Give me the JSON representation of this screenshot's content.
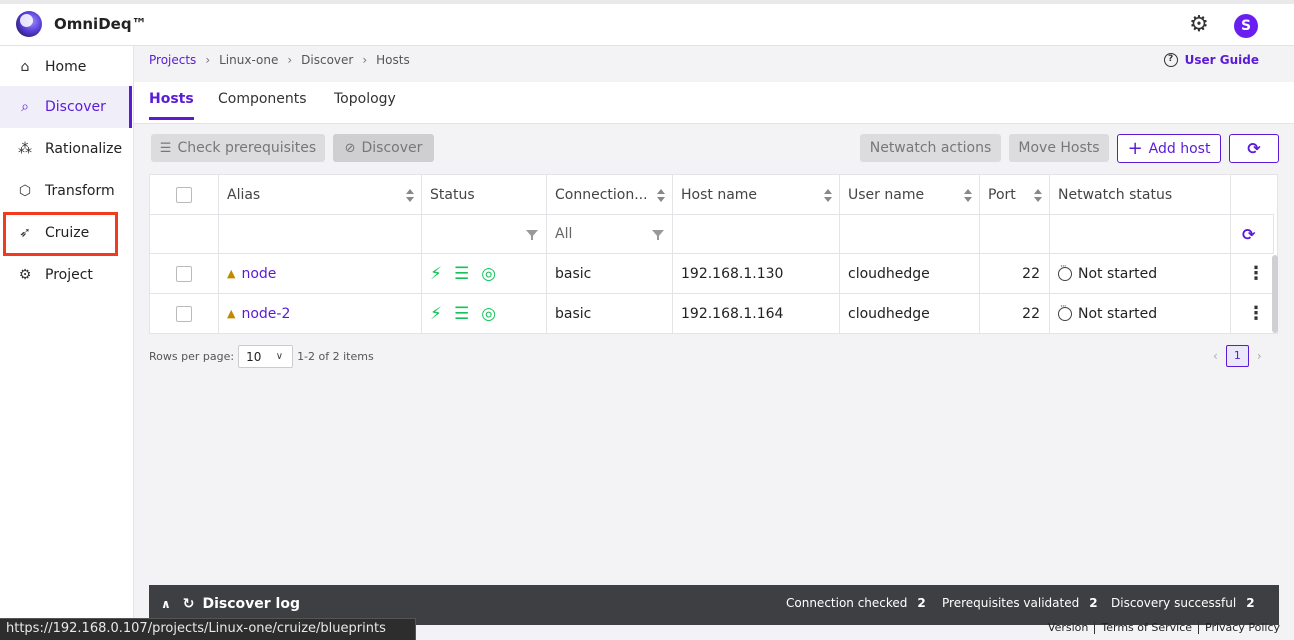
{
  "app": {
    "brand": "OmniDeq™",
    "avatar_letter": "S"
  },
  "sidebar": {
    "items": [
      {
        "label": "Home",
        "icon": "home-icon"
      },
      {
        "label": "Discover",
        "icon": "discover-icon",
        "active": true
      },
      {
        "label": "Rationalize",
        "icon": "rationalize-icon"
      },
      {
        "label": "Transform",
        "icon": "cube-icon"
      },
      {
        "label": "Cruize",
        "icon": "cruize-icon",
        "highlighted": true
      },
      {
        "label": "Project",
        "icon": "gear-icon"
      }
    ]
  },
  "breadcrumb": [
    "Projects",
    "Linux-one",
    "Discover",
    "Hosts"
  ],
  "user_guide": "User Guide",
  "tabs": [
    {
      "label": "Hosts",
      "active": true
    },
    {
      "label": "Components"
    },
    {
      "label": "Topology"
    }
  ],
  "toolbar": {
    "check_prereq": "Check prerequisites",
    "discover": "Discover",
    "netwatch_actions": "Netwatch actions",
    "move_hosts": "Move Hosts",
    "add_host": "Add host"
  },
  "table": {
    "columns": [
      "Alias",
      "Status",
      "Connection...",
      "Host name",
      "User name",
      "Port",
      "Netwatch status"
    ],
    "connection_filter": "All",
    "rows": [
      {
        "alias": "node",
        "connection": "basic",
        "host": "192.168.1.130",
        "user": "cloudhedge",
        "port": "22",
        "netwatch": "Not started"
      },
      {
        "alias": "node-2",
        "connection": "basic",
        "host": "192.168.1.164",
        "user": "cloudhedge",
        "port": "22",
        "netwatch": "Not started"
      }
    ]
  },
  "pagination": {
    "rows_per_page_label": "Rows per page:",
    "rows_per_page": "10",
    "summary": "1-2 of 2 items",
    "current_page": "1"
  },
  "discover_log": {
    "title": "Discover log",
    "stats": [
      {
        "label": "Connection checked",
        "value": "2"
      },
      {
        "label": "Prerequisites validated",
        "value": "2"
      },
      {
        "label": "Discovery successful",
        "value": "2"
      }
    ]
  },
  "status_url": "https://192.168.0.107/projects/Linux-one/cruize/blueprints",
  "footer": [
    "Version",
    "Terms of Service",
    "Privacy Policy"
  ],
  "colors": {
    "accent": "#5a1bd8",
    "status_green": "#16c35a",
    "highlight": "#f23a20"
  }
}
